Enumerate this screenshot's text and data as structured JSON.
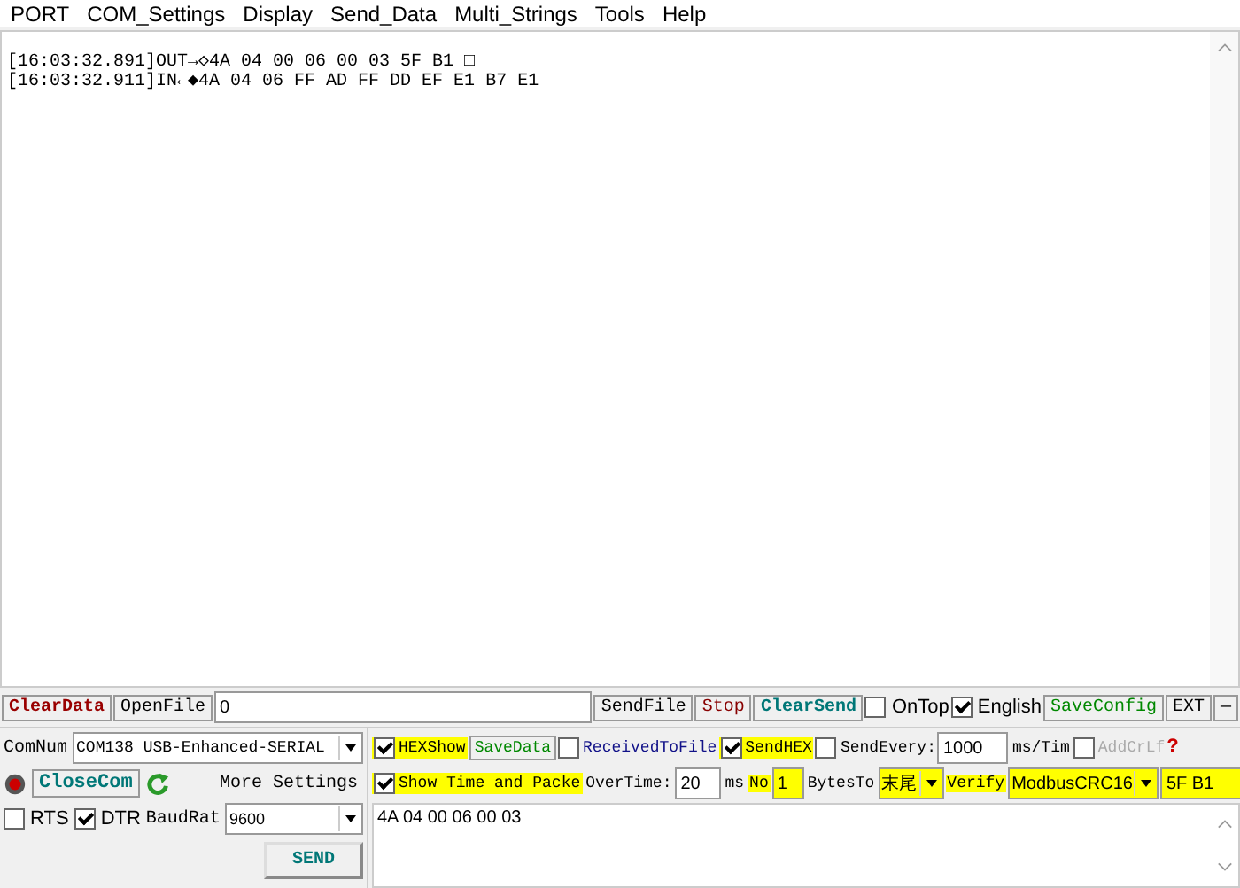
{
  "menu": [
    "PORT",
    "COM_Settings",
    "Display",
    "Send_Data",
    "Multi_Strings",
    "Tools",
    "Help"
  ],
  "log": {
    "lines": [
      "[16:03:32.891]OUT→◇4A 04 00 06 00 03 5F B1 □",
      "[16:03:32.911]IN←◆4A 04 06 FF AD FF DD EF E1 B7 E1"
    ]
  },
  "toolbar": {
    "clear_data": "ClearData",
    "open_file": "OpenFile",
    "file_path": "0",
    "send_file": "SendFile",
    "stop": "Stop",
    "clear_send": "ClearSend",
    "on_top": {
      "label": "OnTop",
      "checked": false
    },
    "english": {
      "label": "English",
      "checked": true
    },
    "save_config": "SaveConfig",
    "ext": "EXT",
    "minimize": "—"
  },
  "port": {
    "com_label": "ComNum",
    "com_value": "COM138 USB-Enhanced-SERIAL",
    "close_com": "CloseCom",
    "more_settings": "More Settings",
    "rts": {
      "label": "RTS",
      "checked": false
    },
    "dtr": {
      "label": "DTR",
      "checked": true
    },
    "baud_label": "BaudRat",
    "baud_value": "9600",
    "send": "SEND"
  },
  "options": {
    "hex_show": {
      "label": "HEXShow",
      "checked": true
    },
    "save_data": "SaveData",
    "received_to_file": {
      "label": "ReceivedToFile",
      "checked": false
    },
    "send_hex": {
      "label": "SendHEX",
      "checked": true
    },
    "send_every": {
      "label": "SendEvery:",
      "checked": false
    },
    "interval": "1000",
    "interval_unit": "ms/Tim",
    "add_crlf": {
      "label": "AddCrLf",
      "checked": false,
      "disabled": true
    },
    "help": "?",
    "show_time": {
      "label": "Show Time and Packe",
      "checked": true
    },
    "overtime_label": "OverTime:",
    "overtime": "20",
    "overtime_unit": "ms",
    "no_label": "No",
    "no_value": "1",
    "bytes_to_label": "BytesTo",
    "bytes_to": "末尾",
    "verify_label": "Verify",
    "verify": "ModbusCRC16",
    "checksum": "5F B1"
  },
  "send_text": "4A 04 00 06 00 03"
}
